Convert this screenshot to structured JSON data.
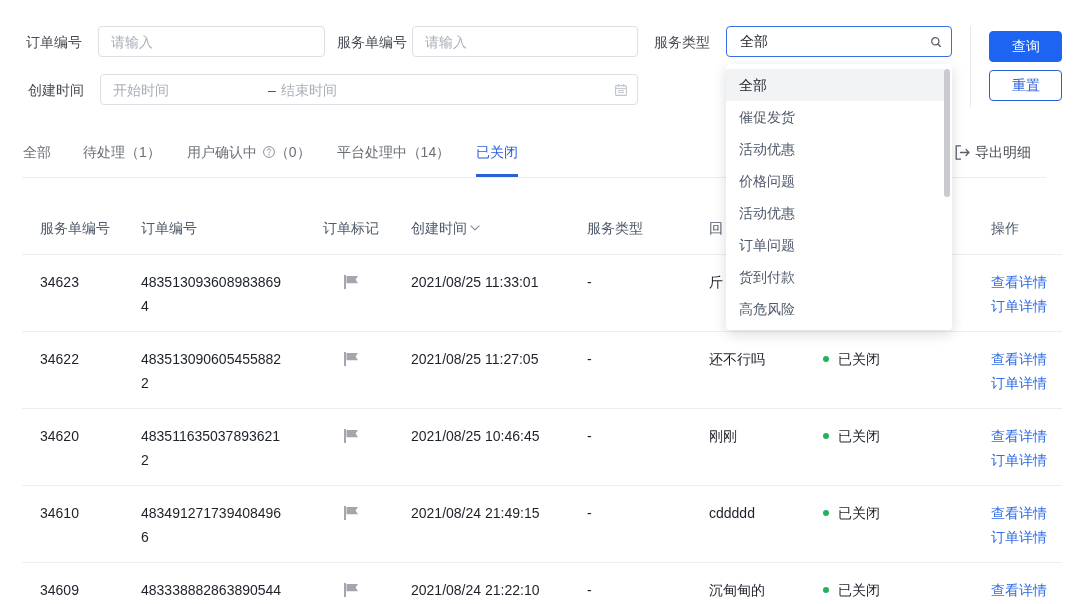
{
  "filters": {
    "order_no": {
      "label": "订单编号",
      "placeholder": "请输入"
    },
    "service_no": {
      "label": "服务单编号",
      "placeholder": "请输入"
    },
    "service_type": {
      "label": "服务类型",
      "value": "全部",
      "open": true,
      "options": [
        {
          "label": "全部",
          "selected": true
        },
        {
          "label": "催促发货",
          "selected": false
        },
        {
          "label": "活动优惠",
          "selected": false
        },
        {
          "label": "价格问题",
          "selected": false
        },
        {
          "label": "活动优惠",
          "selected": false
        },
        {
          "label": "订单问题",
          "selected": false
        },
        {
          "label": "货到付款",
          "selected": false
        },
        {
          "label": "高危风险",
          "selected": false
        }
      ]
    },
    "created_time": {
      "label": "创建时间",
      "start_placeholder": "开始时间",
      "separator": "–",
      "end_placeholder": "结束时间"
    }
  },
  "buttons": [
    {
      "label": "查询",
      "kind": "primary"
    },
    {
      "label": "重置",
      "kind": "outline"
    }
  ],
  "tabs": [
    {
      "label": "全部",
      "kind": "plain",
      "selected": false
    },
    {
      "label": "待处理",
      "count": "（1）",
      "kind": "plain",
      "selected": false
    },
    {
      "label": "用户确认中",
      "count": "（0）",
      "kind": "help",
      "selected": false
    },
    {
      "label": "平台处理中",
      "count": "（14）",
      "kind": "plain",
      "selected": false
    },
    {
      "label": "已关闭",
      "kind": "plain",
      "selected": true
    }
  ],
  "export": {
    "label": "导出明细"
  },
  "table": {
    "columns": [
      {
        "label": "服务单编号",
        "kind": "plain"
      },
      {
        "label": "订单编号",
        "kind": "plain"
      },
      {
        "label": "订单标记",
        "kind": "plain"
      },
      {
        "label": "创建时间",
        "kind": "sortable"
      },
      {
        "label": "服务类型",
        "kind": "plain"
      },
      {
        "label": "回",
        "kind": "plain"
      },
      {
        "kind": "plain"
      },
      {
        "label": "操作",
        "kind": "plain"
      }
    ],
    "rows": [
      {
        "service_no": "34623",
        "order_no": "4835130936089838694",
        "created_at": "2021/08/25 11:33:01",
        "service_type": "-",
        "reply": "斤",
        "actions": [
          "查看详情",
          "订单详情"
        ]
      },
      {
        "service_no": "34622",
        "order_no": "4835130906054558822",
        "created_at": "2021/08/25 11:27:05",
        "service_type": "-",
        "reply": "还不行吗",
        "status": "已关闭",
        "actions": [
          "查看详情",
          "订单详情"
        ]
      },
      {
        "service_no": "34620",
        "order_no": "4835116350378936212",
        "created_at": "2021/08/25 10:46:45",
        "service_type": "-",
        "reply": "刚刚",
        "status": "已关闭",
        "actions": [
          "查看详情",
          "订单详情"
        ]
      },
      {
        "service_no": "34610",
        "order_no": "4834912717394084966",
        "created_at": "2021/08/24 21:49:15",
        "service_type": "-",
        "reply": "cddddd",
        "status": "已关闭",
        "actions": [
          "查看详情",
          "订单详情"
        ]
      },
      {
        "service_no": "34609",
        "order_no": "483338882863890544",
        "created_at": "2021/08/24 21:22:10",
        "service_type": "-",
        "reply": "沉甸甸的",
        "status": "已关闭",
        "actions": [
          "查看详情"
        ]
      }
    ]
  }
}
